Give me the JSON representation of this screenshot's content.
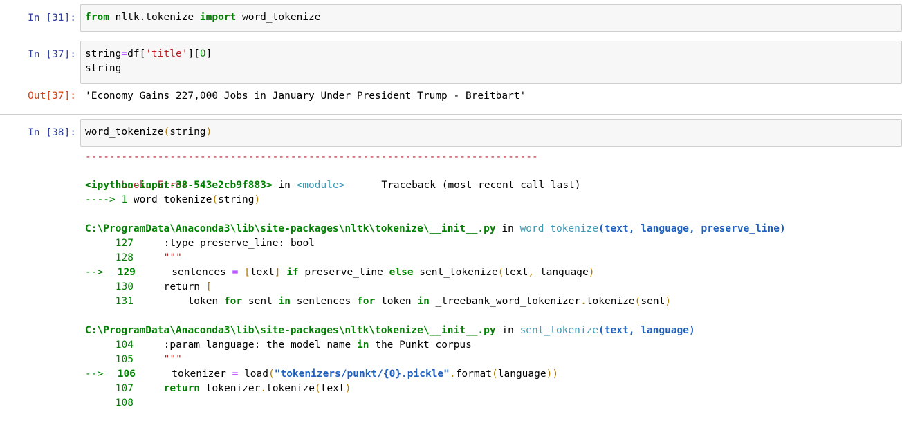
{
  "cells": [
    {
      "prompt": "In [31]:",
      "code": [
        "from nltk.tokenize import word_tokenize"
      ]
    },
    {
      "prompt": "In [37]:",
      "code": [
        "string=df['title'][0]",
        "string"
      ]
    },
    {
      "prompt": "Out[37]:",
      "output": "'Economy Gains 227,000 Jobs in January Under President Trump - Breitbart'"
    },
    {
      "prompt": "In [38]:",
      "code": [
        "word_tokenize(string)"
      ]
    }
  ],
  "traceback": {
    "dashes": "---------------------------------------------------------------------------",
    "error_name": "LookupError",
    "header_right": "Traceback (most recent call last)",
    "input_ref": "<ipython-input-38-543e2cb9f883>",
    "in_word": "in",
    "module": "<module>",
    "arrow_line": "----> 1 word_tokenize(string)",
    "frames": [
      {
        "path": "C:\\ProgramData\\Anaconda3\\lib\\site-packages\\nltk\\tokenize\\__init__.py",
        "in_word": "in",
        "func": "word_tokenize",
        "args": "(text, language, preserve_line)",
        "lines": [
          {
            "no": "127",
            "text": ":type preserve_line: bool"
          },
          {
            "no": "128",
            "text": "\"\"\""
          },
          {
            "no": "129",
            "text": "sentences = [text] if preserve_line else sent_tokenize(text, language)",
            "current": true
          },
          {
            "no": "130",
            "text": "return ["
          },
          {
            "no": "131",
            "text": "    token for sent in sentences for token in _treebank_word_tokenizer.tokenize(sent)"
          }
        ]
      },
      {
        "path": "C:\\ProgramData\\Anaconda3\\lib\\site-packages\\nltk\\tokenize\\__init__.py",
        "in_word": "in",
        "func": "sent_tokenize",
        "args": "(text, language)",
        "lines": [
          {
            "no": "104",
            "text": ":param language: the model name in the Punkt corpus"
          },
          {
            "no": "105",
            "text": "\"\"\""
          },
          {
            "no": "106",
            "text": "tokenizer = load(\"tokenizers/punkt/{0}.pickle\".format(language))",
            "current": true
          },
          {
            "no": "107",
            "text": "return tokenizer.tokenize(text)"
          },
          {
            "no": "108",
            "text": ""
          }
        ]
      }
    ],
    "current_arrow": "-->"
  }
}
